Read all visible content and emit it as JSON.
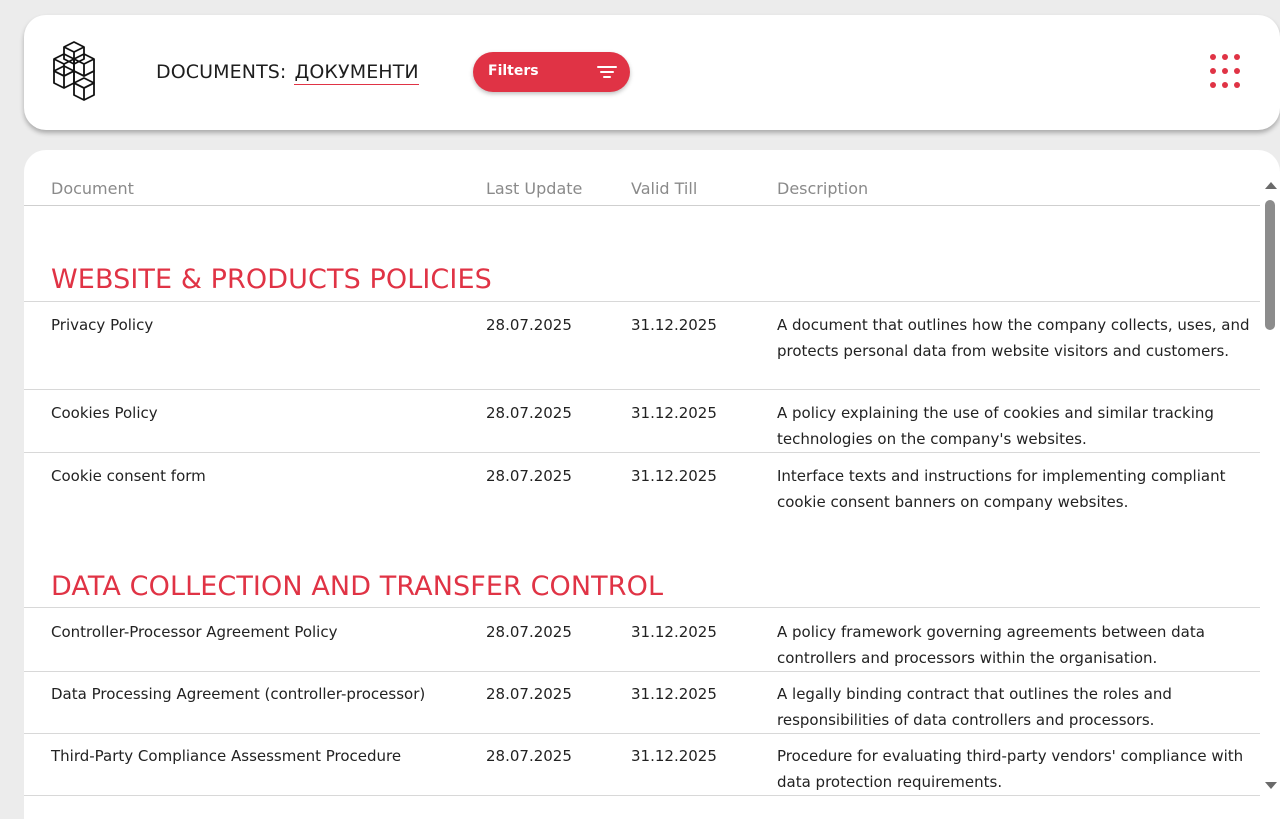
{
  "header": {
    "title": "DOCUMENTS:",
    "language_link": "ДОКУМЕНТИ",
    "filters_label": "Filters",
    "accent_color": "#e03345",
    "logo_icon": "stacked-cubes-logo",
    "menu_icon": "grid-dots-icon",
    "filter_icon": "filter-lines-icon"
  },
  "table": {
    "columns": [
      "Document",
      "Last Update",
      "Valid Till",
      "Description"
    ],
    "sections": [
      {
        "title": "WEBSITE & PRODUCTS POLICIES",
        "rows": [
          {
            "document": "Privacy Policy",
            "last_update": "28.07.2025",
            "valid_till": "31.12.2025",
            "description": "A document that outlines how the company collects, uses, and protects personal data from website visitors and customers."
          },
          {
            "document": "Cookies Policy",
            "last_update": "28.07.2025",
            "valid_till": "31.12.2025",
            "description": "A policy explaining the use of cookies and similar tracking technologies on the company's websites."
          },
          {
            "document": "Cookie consent form",
            "last_update": "28.07.2025",
            "valid_till": "31.12.2025",
            "description": "Interface texts and instructions for implementing compliant cookie consent banners on company websites."
          }
        ]
      },
      {
        "title": "DATA COLLECTION AND TRANSFER CONTROL",
        "rows": [
          {
            "document": "Controller-Processor Agreement Policy",
            "last_update": "28.07.2025",
            "valid_till": "31.12.2025",
            "description": "A policy framework governing agreements between data controllers and processors within the organisation."
          },
          {
            "document": "Data Processing Agreement (controller-processor)",
            "last_update": "28.07.2025",
            "valid_till": "31.12.2025",
            "description": "A legally binding contract that outlines the roles and responsibilities of data controllers and processors."
          },
          {
            "document": "Third-Party Compliance Assessment Procedure",
            "last_update": "28.07.2025",
            "valid_till": "31.12.2025",
            "description": "Procedure for evaluating third-party vendors' compliance with data protection requirements."
          }
        ]
      }
    ]
  }
}
